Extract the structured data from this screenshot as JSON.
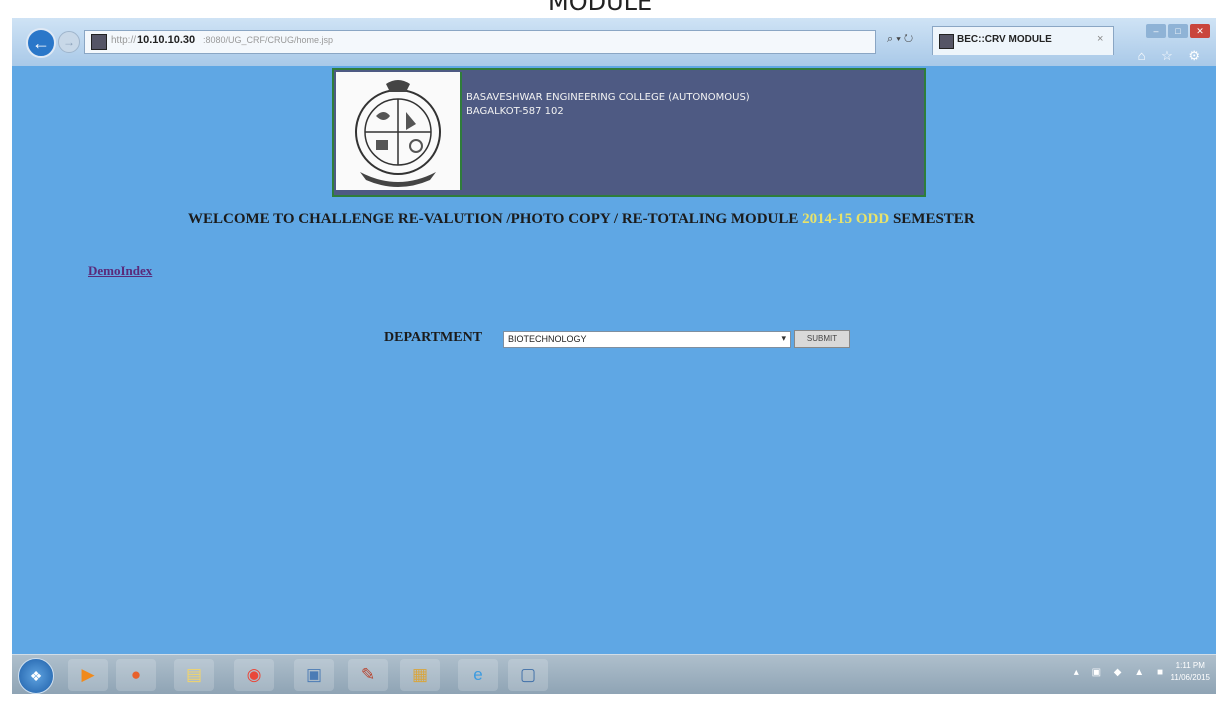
{
  "document": {
    "caption": "MODULE"
  },
  "browser": {
    "address": {
      "scheme": "http://",
      "host": "10.10.10.30",
      "path": ":8080/UG_CRF/CRUG/home.jsp"
    },
    "search_control": "⌕ ▾ ↻",
    "tab": {
      "title": "BEC::CRV MODULE",
      "close": "×"
    },
    "back_glyph": "←",
    "forward_glyph": "→",
    "window_controls": {
      "minimize": "–",
      "maximize": "□",
      "close": "✕"
    },
    "toolbar_icons": "⌂ ☆ ⚙"
  },
  "header": {
    "college_name": "BASAVESHWAR ENGINEERING COLLEGE (AUTONOMOUS)",
    "college_address": "BAGALKOT-587 102"
  },
  "welcome": {
    "text": "WELCOME TO CHALLENGE RE-VALUTION /PHOTO COPY / RE-TOTALING MODULE ",
    "highlight": "2014-15 ODD",
    "suffix": " SEMESTER"
  },
  "links": {
    "demo_index": "DemoIndex"
  },
  "form": {
    "department_label": "DEPARTMENT",
    "department_selected": "BIOTECHNOLOGY",
    "submit_label": "SUBMIT"
  },
  "taskbar": {
    "items": [
      {
        "name": "media-player-icon",
        "glyph": "▶",
        "color": "#f08a1c"
      },
      {
        "name": "firefox-icon",
        "glyph": "●",
        "color": "#e8612c"
      },
      {
        "name": "file-explorer-icon",
        "glyph": "▤",
        "color": "#f2d46a"
      },
      {
        "name": "chrome-icon",
        "glyph": "◉",
        "color": "#e9483b"
      },
      {
        "name": "system-app-icon",
        "glyph": "▣",
        "color": "#4b7bb5"
      },
      {
        "name": "paint-icon",
        "glyph": "✎",
        "color": "#b8432e"
      },
      {
        "name": "library-icon",
        "glyph": "▦",
        "color": "#d9a53c"
      },
      {
        "name": "internet-explorer-icon",
        "glyph": "e",
        "color": "#3d9be0"
      },
      {
        "name": "window-app-icon",
        "glyph": "▢",
        "color": "#3f6fa8"
      }
    ],
    "tray_icons": "▴ ▣ ◆ ▲ ■",
    "clock_time": "1:11 PM",
    "clock_date": "11/06/2015"
  },
  "colors": {
    "page_background": "#5fa7e4",
    "banner_background": "#4e5a83",
    "banner_border": "#2f7d3a",
    "highlight_text": "#e8e36a"
  }
}
